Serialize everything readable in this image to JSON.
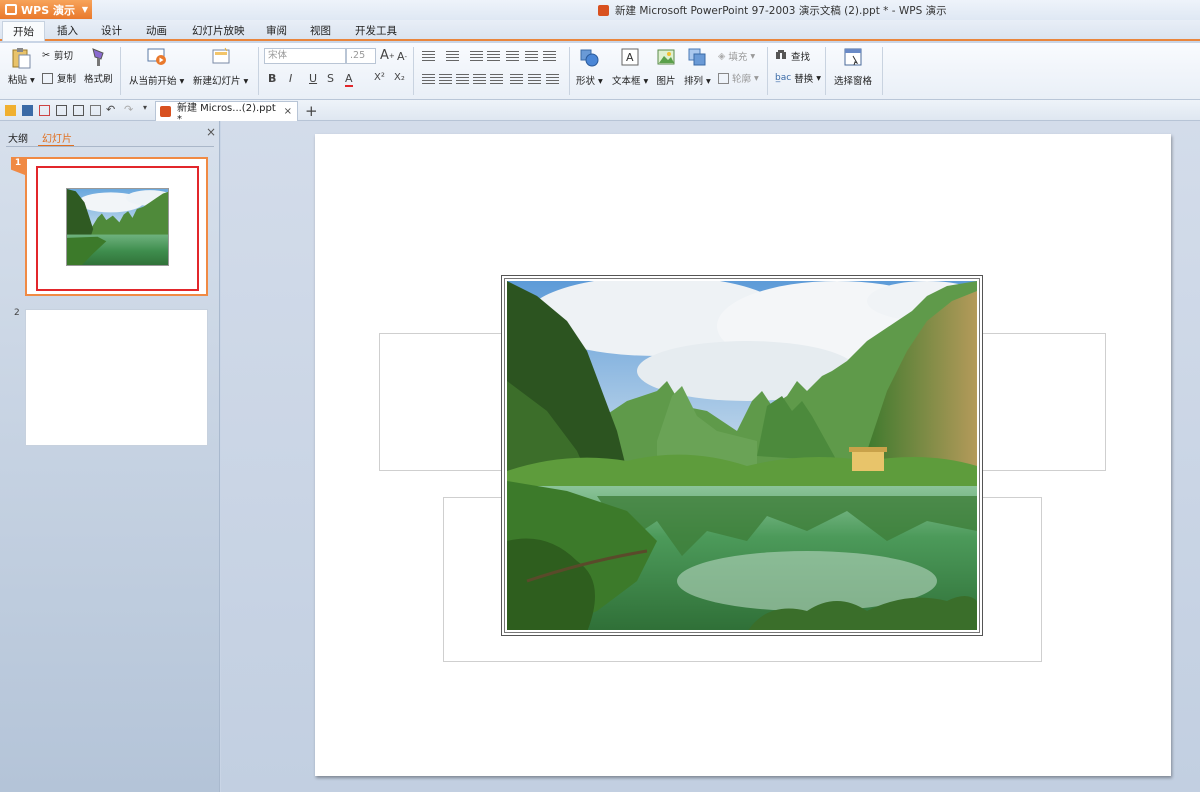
{
  "app": {
    "menu_button": "WPS 演示",
    "window_title": "新建 Microsoft PowerPoint 97-2003 演示文稿 (2).ppt * - WPS 演示"
  },
  "menu_tabs": [
    "开始",
    "插入",
    "设计",
    "动画",
    "幻灯片放映",
    "审阅",
    "视图",
    "开发工具"
  ],
  "ribbon": {
    "paste": "粘贴",
    "cut": "剪切",
    "copy": "复制",
    "format_painter": "格式刷",
    "from_current": "从当前开始",
    "new_slide": "新建幻灯片",
    "font_name": "宋体",
    "font_size": ".25",
    "bold": "B",
    "italic": "I",
    "underline": "U",
    "shadow": "S",
    "font_color": "A",
    "superscript": "X²",
    "subscript": "X₂",
    "shape": "形状",
    "textbox": "文本框",
    "picture": "图片",
    "arrange": "排列",
    "fill": "填充",
    "outline": "轮廓",
    "find": "查找",
    "replace": "替换",
    "selection_pane": "选择窗格"
  },
  "doc_tab": {
    "label": "新建 Micros...(2).ppt *",
    "close": "×",
    "add": "+"
  },
  "left_panel": {
    "tabs": [
      "大纲",
      "幻灯片"
    ],
    "active_tab": "幻灯片",
    "close": "×",
    "slides": [
      {
        "number": "1",
        "selected": true,
        "has_picture": true
      },
      {
        "number": "2",
        "selected": false,
        "has_picture": false
      }
    ]
  },
  "colors": {
    "accent_orange": "#e9792c",
    "selection_red": "#e2262b",
    "ribbon_bg": "#eef3f9",
    "workspace_bg": "#c2cfe1"
  },
  "icons": [
    "wps-logo-icon",
    "ppt-file-icon",
    "paste-icon",
    "cut-icon",
    "copy-icon",
    "format-painter-icon",
    "play-from-current-icon",
    "new-slide-icon",
    "shape-icon",
    "textbox-icon",
    "picture-icon",
    "arrange-icon",
    "find-icon",
    "replace-icon",
    "selection-pane-icon"
  ]
}
